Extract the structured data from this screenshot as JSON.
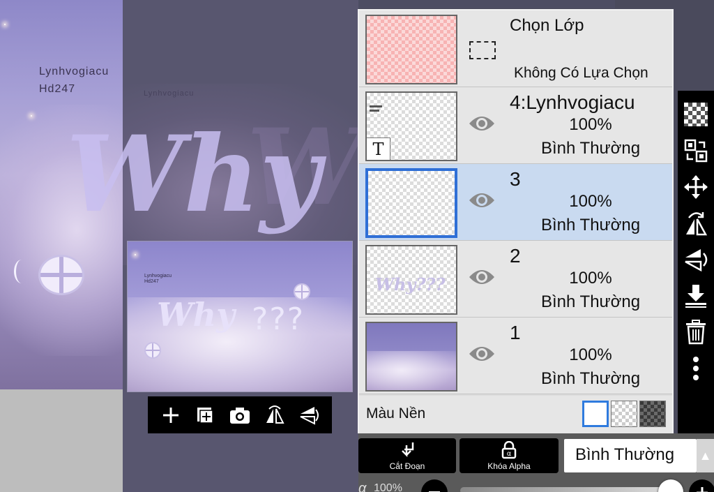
{
  "canvas": {
    "watermark_line1": "Lynhvogiacu",
    "watermark_line2": "Hd247",
    "big_text": "Why",
    "preview_text_line1": "Lynhvogiacu",
    "preview_text_line2": "Hd247",
    "preview_word": "Why",
    "preview_marks": "???"
  },
  "canvas_toolbar": [
    {
      "name": "add-layer-button",
      "icon": "plus-icon"
    },
    {
      "name": "add-layer-copy-button",
      "icon": "add-copy-icon"
    },
    {
      "name": "camera-import-button",
      "icon": "camera-icon"
    },
    {
      "name": "flip-horizontal-button",
      "icon": "flip-horizontal-icon"
    },
    {
      "name": "flip-vertical-button",
      "icon": "flip-vertical-icon"
    }
  ],
  "layers_panel": {
    "selection_row": {
      "title": "Chọn Lớp",
      "subtitle": "Không Có Lựa Chọn"
    },
    "layers": [
      {
        "name": "4:Lynhvogiacu",
        "opacity": "100%",
        "mode": "Bình Thường",
        "type": "text"
      },
      {
        "name": "3",
        "opacity": "100%",
        "mode": "Bình Thường",
        "type": "empty",
        "selected": true
      },
      {
        "name": "2",
        "opacity": "100%",
        "mode": "Bình Thường",
        "type": "drawing"
      },
      {
        "name": "1",
        "opacity": "100%",
        "mode": "Bình Thường",
        "type": "photo"
      }
    ],
    "text_badge": "T",
    "thumb_word": "Why???",
    "background": {
      "label": "Màu Nền",
      "options": [
        "white",
        "transparent",
        "dark-checker"
      ],
      "selected": "white"
    }
  },
  "right_tools": [
    "checker-icon",
    "swap-layers-icon",
    "move-icon",
    "flip-horizontal-rotate-icon",
    "flip-vertical-rotate-icon",
    "merge-down-icon",
    "trash-icon",
    "more-icon"
  ],
  "bottom": {
    "cut_label": "Cắt Đoạn",
    "alpha_lock_label": "Khóa Alpha",
    "blend_mode": "Bình Thường",
    "alpha_symbol": "α",
    "alpha_value": "100%",
    "opacity_fraction": 1.0
  },
  "colors": {
    "selected_row": "#c9daf0",
    "selected_border": "#2f6fd6",
    "panel_bg": "#e6e6e6",
    "toolbar_bg": "#000000"
  }
}
